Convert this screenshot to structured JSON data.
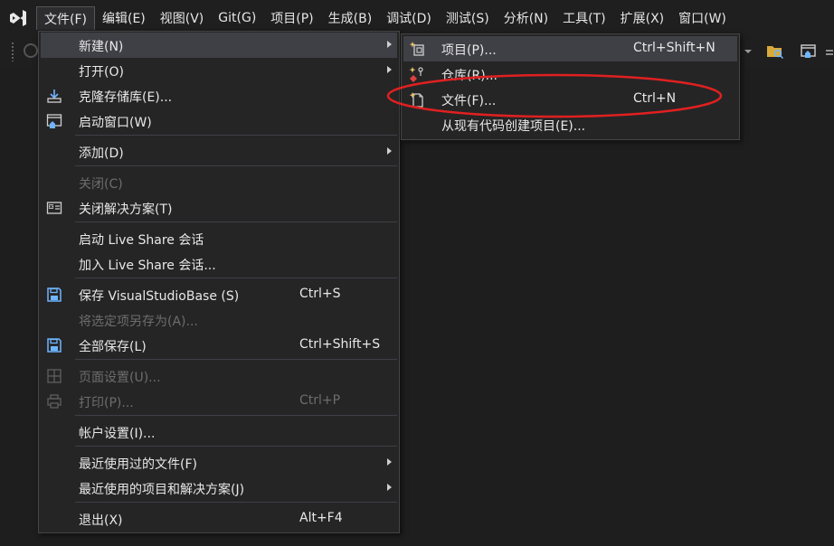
{
  "menubar": {
    "items": [
      "文件(F)",
      "编辑(E)",
      "视图(V)",
      "Git(G)",
      "项目(P)",
      "生成(B)",
      "调试(D)",
      "测试(S)",
      "分析(N)",
      "工具(T)",
      "扩展(X)",
      "窗口(W)"
    ]
  },
  "file_menu": {
    "new": "新建(N)",
    "open": "打开(O)",
    "clone": "克隆存储库(E)...",
    "start_window": "启动窗口(W)",
    "add": "添加(D)",
    "close": "关闭(C)",
    "close_solution": "关闭解决方案(T)",
    "start_live_share": "启动 Live Share 会话",
    "join_live_share": "加入 Live Share 会话...",
    "save": "保存 VisualStudioBase (S)",
    "save_shortcut": "Ctrl+S",
    "save_as": "将选定项另存为(A)...",
    "save_all": "全部保存(L)",
    "save_all_shortcut": "Ctrl+Shift+S",
    "page_setup": "页面设置(U)...",
    "print": "打印(P)...",
    "print_shortcut": "Ctrl+P",
    "account_settings": "帐户设置(I)...",
    "recent_files": "最近使用过的文件(F)",
    "recent_projects": "最近使用的项目和解决方案(J)",
    "exit": "退出(X)",
    "exit_shortcut": "Alt+F4"
  },
  "new_submenu": {
    "project": "项目(P)...",
    "project_shortcut": "Ctrl+Shift+N",
    "repository": "仓库(R)...",
    "file": "文件(F)...",
    "file_shortcut": "Ctrl+N",
    "from_existing": "从现有代码创建项目(E)..."
  },
  "colors": {
    "menu_bg": "#252526",
    "highlight": "#3f3f46",
    "annotation": "#e02020",
    "vs_purple": "#a587d8"
  }
}
